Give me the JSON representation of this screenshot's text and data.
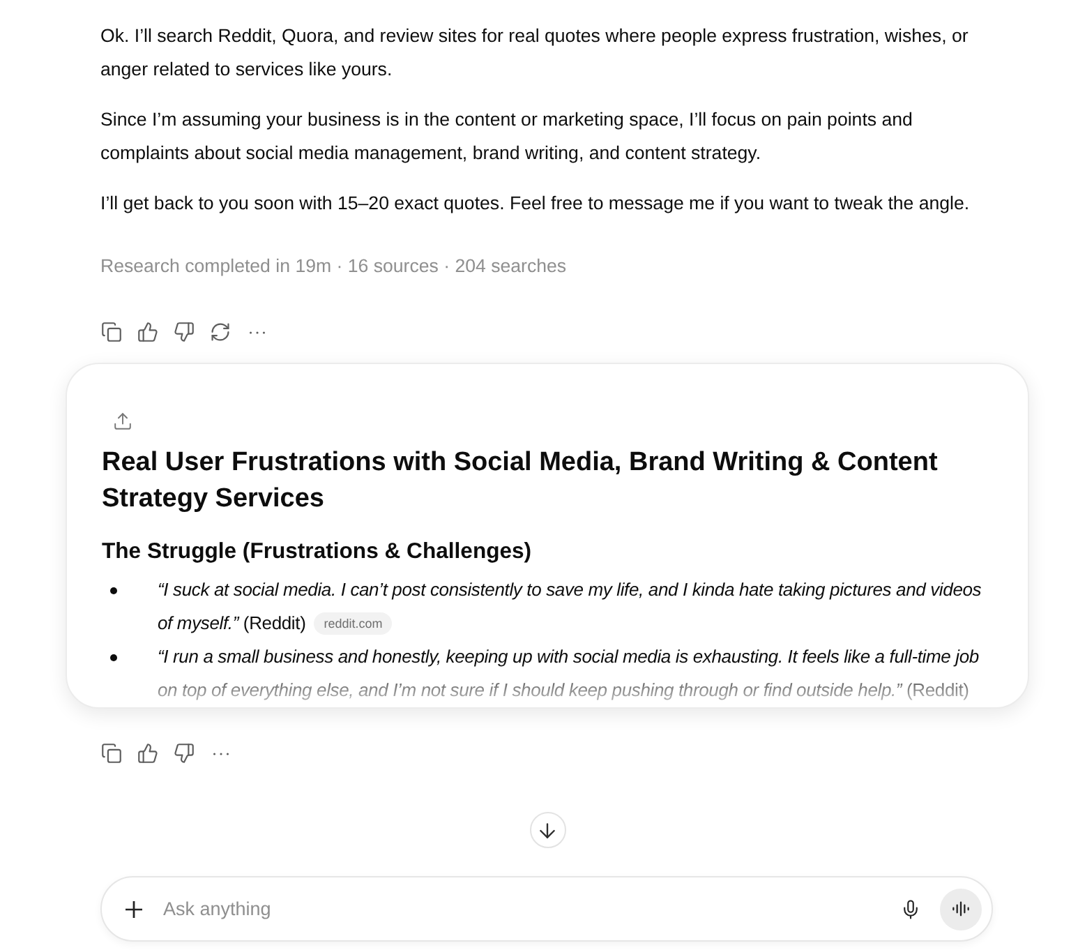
{
  "message": {
    "paragraphs": [
      "Ok. I’ll search Reddit, Quora, and review sites for real quotes where people express frustration, wishes, or anger related to services like yours.",
      "Since I’m assuming your business is in the content or marketing space, I’ll focus on pain points and complaints about social media management, brand writing, and content strategy.",
      "I’ll get back to you soon with 15–20 exact quotes. Feel free to message me if you want to tweak the angle."
    ],
    "research_status": "Research completed in 19m · 16 sources · 204 searches"
  },
  "report": {
    "title": "Real User Frustrations with Social Media, Brand Writing & Content Strategy Services",
    "sections": [
      {
        "heading": "The Struggle (Frustrations & Challenges)",
        "items": [
          {
            "text": "*“I suck at social media. I can’t post consistently to save my life, and I kinda hate taking pictures and videos of myself.”* (Reddit)",
            "source": "reddit.com"
          },
          {
            "text": "*“I run a small business and honestly, keeping up with social media is exhausting. It feels like a full-time job on top of everything else, and I’m not sure if I should keep pushing through or find outside help.”* (Reddit)"
          }
        ]
      }
    ]
  },
  "composer": {
    "placeholder": "Ask anything"
  }
}
